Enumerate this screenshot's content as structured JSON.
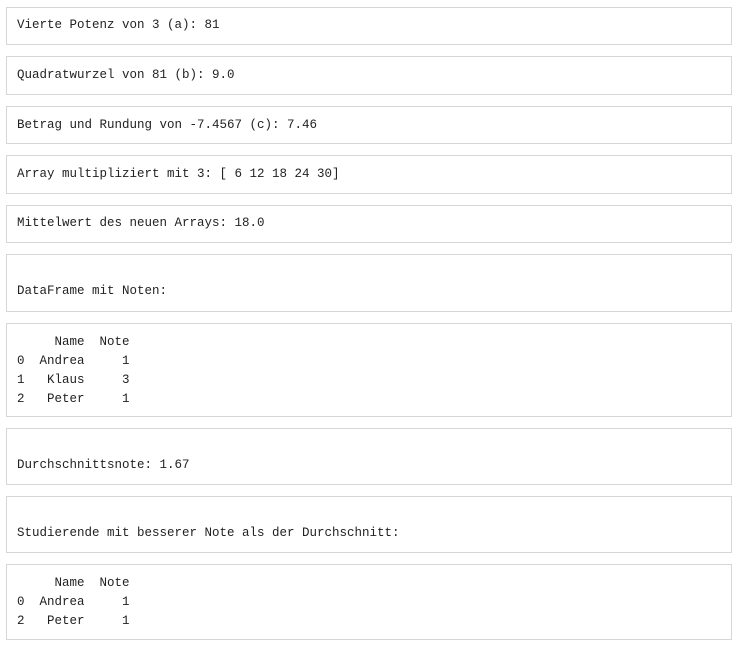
{
  "outputs": [
    "Vierte Potenz von 3 (a): 81",
    "Quadratwurzel von 81 (b): 9.0",
    "Betrag und Rundung von -7.4567 (c): 7.46",
    "Array multipliziert mit 3: [ 6 12 18 24 30]",
    "Mittelwert des neuen Arrays: 18.0",
    "DataFrame mit Noten:",
    "     Name  Note\n0  Andrea     1\n1   Klaus     3\n2   Peter     1",
    "Durchschnittsnote: 1.67",
    "Studierende mit besserer Note als der Durchschnitt:",
    "     Name  Note\n0  Andrea     1\n2   Peter     1"
  ]
}
